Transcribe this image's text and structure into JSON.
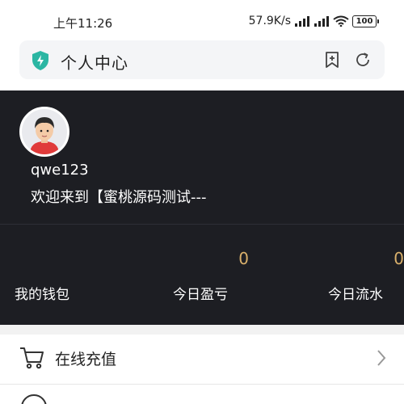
{
  "status_bar": {
    "time": "上午11:26",
    "network_speed": "57.9K/s",
    "battery": "100"
  },
  "address_bar": {
    "title": "个人中心",
    "icons": [
      "shield-icon",
      "bookmark-icon",
      "refresh-icon"
    ]
  },
  "profile": {
    "username": "qwe123",
    "welcome": "欢迎来到【蜜桃源码测试---"
  },
  "stats": {
    "wallet_label": "我的钱包",
    "pnl_value": "0",
    "pnl_label": "今日盈亏",
    "flow_value": "0",
    "flow_label": "今日流水"
  },
  "menu": {
    "items": [
      {
        "label": "在线充值",
        "icon": "cart-icon"
      }
    ]
  },
  "colors": {
    "profile_bg": "#1d1e23",
    "stat_value": "#d9b06b",
    "accent_shield": "#2bb6a3"
  }
}
